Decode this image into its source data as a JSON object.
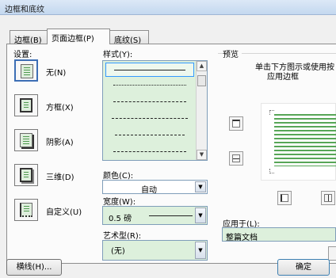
{
  "window": {
    "title": "边框和底纹"
  },
  "tabs": [
    {
      "label": "边框(B)"
    },
    {
      "label": "页面边框(P)"
    },
    {
      "label": "底纹(S)"
    }
  ],
  "settings": {
    "heading": "设置:",
    "items": [
      {
        "label": "无(N)"
      },
      {
        "label": "方框(X)"
      },
      {
        "label": "阴影(A)"
      },
      {
        "label": "三维(D)"
      },
      {
        "label": "自定义(U)"
      }
    ]
  },
  "style": {
    "heading": "样式(Y):"
  },
  "color": {
    "label": "颜色(C):",
    "value": "自动"
  },
  "width": {
    "label": "宽度(W):",
    "value": "0.5 磅"
  },
  "art": {
    "label": "艺术型(R):",
    "value": "(无)"
  },
  "preview": {
    "heading": "预览",
    "instruction_line1": "单击下方图示或使用按",
    "instruction_line2": "应用边框"
  },
  "apply_to": {
    "label": "应用于(L):",
    "value": "整篇文档"
  },
  "buttons": {
    "horizontal_line": "横线(H)...",
    "ok": "确定"
  }
}
